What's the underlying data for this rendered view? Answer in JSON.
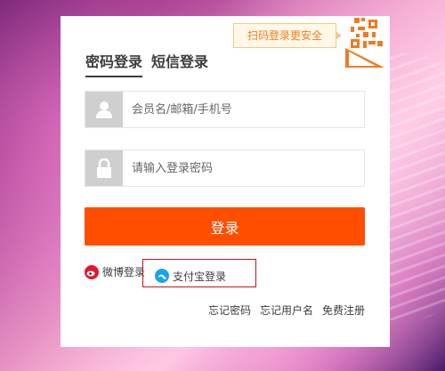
{
  "login": {
    "qr_tip": "扫码登录更安全",
    "tabs": [
      {
        "label": "密码登录",
        "active": true
      },
      {
        "label": "短信登录",
        "active": false
      }
    ],
    "username": {
      "placeholder": "会员名/邮箱/手机号",
      "value": "",
      "icon": "user-icon"
    },
    "password": {
      "placeholder": "请输入登录密码",
      "value": "",
      "icon": "lock-icon"
    },
    "submit_label": "登录",
    "alt_logins": [
      {
        "label": "微博登录",
        "icon": "weibo-icon"
      },
      {
        "label": "支付宝登录",
        "icon": "alipay-icon"
      }
    ],
    "links": {
      "forgot_password": "忘记密码",
      "forgot_username": "忘记用户名",
      "register": "免费注册"
    }
  },
  "colors": {
    "accent": "#ff4e00",
    "tip_text": "#f07b22",
    "highlight_outline": "#c81414"
  }
}
